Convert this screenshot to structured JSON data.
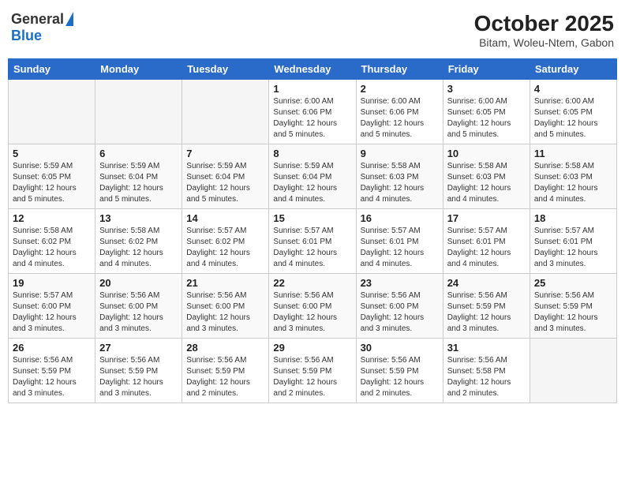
{
  "header": {
    "logo_general": "General",
    "logo_blue": "Blue",
    "month_title": "October 2025",
    "location": "Bitam, Woleu-Ntem, Gabon"
  },
  "days_of_week": [
    "Sunday",
    "Monday",
    "Tuesday",
    "Wednesday",
    "Thursday",
    "Friday",
    "Saturday"
  ],
  "weeks": [
    [
      {
        "day": "",
        "info": ""
      },
      {
        "day": "",
        "info": ""
      },
      {
        "day": "",
        "info": ""
      },
      {
        "day": "1",
        "info": "Sunrise: 6:00 AM\nSunset: 6:06 PM\nDaylight: 12 hours\nand 5 minutes."
      },
      {
        "day": "2",
        "info": "Sunrise: 6:00 AM\nSunset: 6:06 PM\nDaylight: 12 hours\nand 5 minutes."
      },
      {
        "day": "3",
        "info": "Sunrise: 6:00 AM\nSunset: 6:05 PM\nDaylight: 12 hours\nand 5 minutes."
      },
      {
        "day": "4",
        "info": "Sunrise: 6:00 AM\nSunset: 6:05 PM\nDaylight: 12 hours\nand 5 minutes."
      }
    ],
    [
      {
        "day": "5",
        "info": "Sunrise: 5:59 AM\nSunset: 6:05 PM\nDaylight: 12 hours\nand 5 minutes."
      },
      {
        "day": "6",
        "info": "Sunrise: 5:59 AM\nSunset: 6:04 PM\nDaylight: 12 hours\nand 5 minutes."
      },
      {
        "day": "7",
        "info": "Sunrise: 5:59 AM\nSunset: 6:04 PM\nDaylight: 12 hours\nand 5 minutes."
      },
      {
        "day": "8",
        "info": "Sunrise: 5:59 AM\nSunset: 6:04 PM\nDaylight: 12 hours\nand 4 minutes."
      },
      {
        "day": "9",
        "info": "Sunrise: 5:58 AM\nSunset: 6:03 PM\nDaylight: 12 hours\nand 4 minutes."
      },
      {
        "day": "10",
        "info": "Sunrise: 5:58 AM\nSunset: 6:03 PM\nDaylight: 12 hours\nand 4 minutes."
      },
      {
        "day": "11",
        "info": "Sunrise: 5:58 AM\nSunset: 6:03 PM\nDaylight: 12 hours\nand 4 minutes."
      }
    ],
    [
      {
        "day": "12",
        "info": "Sunrise: 5:58 AM\nSunset: 6:02 PM\nDaylight: 12 hours\nand 4 minutes."
      },
      {
        "day": "13",
        "info": "Sunrise: 5:58 AM\nSunset: 6:02 PM\nDaylight: 12 hours\nand 4 minutes."
      },
      {
        "day": "14",
        "info": "Sunrise: 5:57 AM\nSunset: 6:02 PM\nDaylight: 12 hours\nand 4 minutes."
      },
      {
        "day": "15",
        "info": "Sunrise: 5:57 AM\nSunset: 6:01 PM\nDaylight: 12 hours\nand 4 minutes."
      },
      {
        "day": "16",
        "info": "Sunrise: 5:57 AM\nSunset: 6:01 PM\nDaylight: 12 hours\nand 4 minutes."
      },
      {
        "day": "17",
        "info": "Sunrise: 5:57 AM\nSunset: 6:01 PM\nDaylight: 12 hours\nand 4 minutes."
      },
      {
        "day": "18",
        "info": "Sunrise: 5:57 AM\nSunset: 6:01 PM\nDaylight: 12 hours\nand 3 minutes."
      }
    ],
    [
      {
        "day": "19",
        "info": "Sunrise: 5:57 AM\nSunset: 6:00 PM\nDaylight: 12 hours\nand 3 minutes."
      },
      {
        "day": "20",
        "info": "Sunrise: 5:56 AM\nSunset: 6:00 PM\nDaylight: 12 hours\nand 3 minutes."
      },
      {
        "day": "21",
        "info": "Sunrise: 5:56 AM\nSunset: 6:00 PM\nDaylight: 12 hours\nand 3 minutes."
      },
      {
        "day": "22",
        "info": "Sunrise: 5:56 AM\nSunset: 6:00 PM\nDaylight: 12 hours\nand 3 minutes."
      },
      {
        "day": "23",
        "info": "Sunrise: 5:56 AM\nSunset: 6:00 PM\nDaylight: 12 hours\nand 3 minutes."
      },
      {
        "day": "24",
        "info": "Sunrise: 5:56 AM\nSunset: 5:59 PM\nDaylight: 12 hours\nand 3 minutes."
      },
      {
        "day": "25",
        "info": "Sunrise: 5:56 AM\nSunset: 5:59 PM\nDaylight: 12 hours\nand 3 minutes."
      }
    ],
    [
      {
        "day": "26",
        "info": "Sunrise: 5:56 AM\nSunset: 5:59 PM\nDaylight: 12 hours\nand 3 minutes."
      },
      {
        "day": "27",
        "info": "Sunrise: 5:56 AM\nSunset: 5:59 PM\nDaylight: 12 hours\nand 3 minutes."
      },
      {
        "day": "28",
        "info": "Sunrise: 5:56 AM\nSunset: 5:59 PM\nDaylight: 12 hours\nand 2 minutes."
      },
      {
        "day": "29",
        "info": "Sunrise: 5:56 AM\nSunset: 5:59 PM\nDaylight: 12 hours\nand 2 minutes."
      },
      {
        "day": "30",
        "info": "Sunrise: 5:56 AM\nSunset: 5:59 PM\nDaylight: 12 hours\nand 2 minutes."
      },
      {
        "day": "31",
        "info": "Sunrise: 5:56 AM\nSunset: 5:58 PM\nDaylight: 12 hours\nand 2 minutes."
      },
      {
        "day": "",
        "info": ""
      }
    ]
  ]
}
